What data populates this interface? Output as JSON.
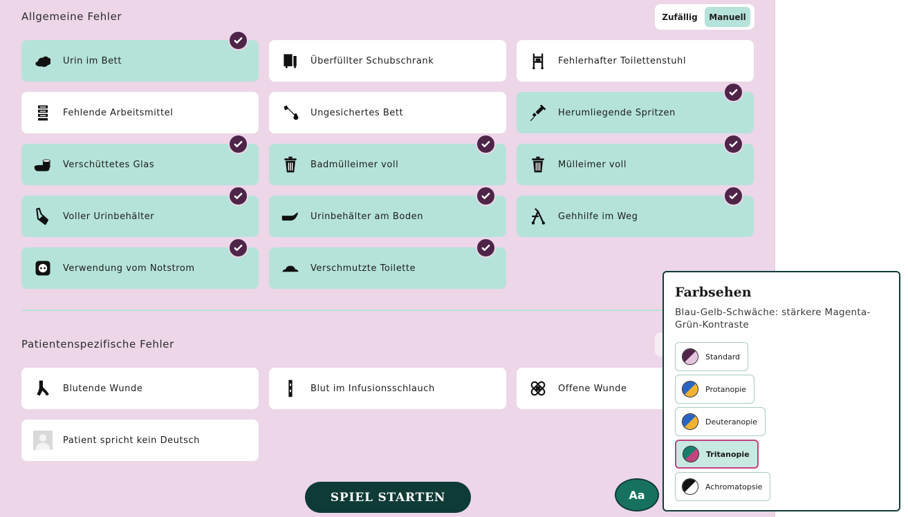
{
  "general": {
    "title": "Allgemeine Fehler",
    "mode_toggle": {
      "random_label": "Zufällig",
      "manual_label": "Manuell",
      "selected": "Manuell"
    },
    "items": [
      {
        "label": "Urin im Bett",
        "icon": "urine-stain-icon",
        "selected": true
      },
      {
        "label": "Überfüllter Schubschrank",
        "icon": "drawer-cabinet-icon",
        "selected": false
      },
      {
        "label": "Fehlerhafter Toilettenstuhl",
        "icon": "commode-chair-icon",
        "selected": false
      },
      {
        "label": "Fehlende Arbeitsmittel",
        "icon": "shelf-icon",
        "selected": false
      },
      {
        "label": "Ungesichertes Bett",
        "icon": "wrench-icon",
        "selected": false
      },
      {
        "label": "Herumliegende Spritzen",
        "icon": "syringe-icon",
        "selected": true
      },
      {
        "label": "Verschüttetes Glas",
        "icon": "spilled-glass-icon",
        "selected": true
      },
      {
        "label": "Badmülleimer voll",
        "icon": "trash-can-icon",
        "selected": true
      },
      {
        "label": "Mülleimer voll",
        "icon": "trash-can-icon",
        "selected": true
      },
      {
        "label": "Voller Urinbehälter",
        "icon": "urine-bottle-icon",
        "selected": true
      },
      {
        "label": "Urinbehälter am Boden",
        "icon": "bedpan-icon",
        "selected": true
      },
      {
        "label": "Gehhilfe im Weg",
        "icon": "walker-icon",
        "selected": true
      },
      {
        "label": "Verwendung vom Notstrom",
        "icon": "power-socket-icon",
        "selected": true
      },
      {
        "label": "Verschmutzte Toilette",
        "icon": "toilet-dirt-icon",
        "selected": true
      }
    ]
  },
  "patient": {
    "title": "Patientenspezifische Fehler",
    "items": [
      {
        "label": "Blutende Wunde",
        "icon": "bleeding-icon",
        "selected": false
      },
      {
        "label": "Blut im Infusionsschlauch",
        "icon": "infusion-tube-icon",
        "selected": false
      },
      {
        "label": "Offene Wunde",
        "icon": "bandage-icon",
        "selected": false
      },
      {
        "label": "Patient spricht kein Deutsch",
        "icon": "person-placeholder-icon",
        "selected": false
      }
    ]
  },
  "start_button": "SPIEL STARTEN",
  "font_button": "Aa",
  "color_panel": {
    "title": "Farbsehen",
    "description": "Blau-Gelb-Schwäche: stärkere Magenta-Grün-Kontraste",
    "options": [
      {
        "label": "Standard",
        "color_a": "#4e2549",
        "color_b": "#e6c4df",
        "selected": false
      },
      {
        "label": "Protanopie",
        "color_a": "#2a64c2",
        "color_b": "#f2b230",
        "selected": false
      },
      {
        "label": "Deuteranopie",
        "color_a": "#2a64c2",
        "color_b": "#f2b230",
        "selected": false
      },
      {
        "label": "Tritanopie",
        "color_a": "#16806c",
        "color_b": "#c2437d",
        "selected": true
      },
      {
        "label": "Achromatopsie",
        "color_a": "#111111",
        "color_b": "#ffffff",
        "selected": false
      }
    ]
  },
  "colors": {
    "background": "#ecd6e8",
    "selected_card": "#b5e3d9",
    "check_badge": "#4e2549",
    "start_button": "#0f3b36",
    "font_button": "#16725e"
  }
}
